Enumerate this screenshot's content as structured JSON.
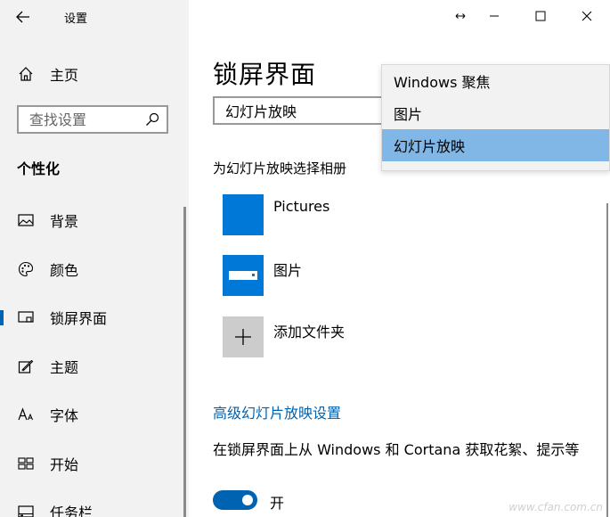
{
  "window": {
    "title": "设置"
  },
  "sidebar": {
    "home_label": "主页",
    "search_placeholder": "查找设置",
    "section_title": "个性化",
    "items": [
      {
        "label": "背景",
        "icon": "picture-icon"
      },
      {
        "label": "颜色",
        "icon": "palette-icon"
      },
      {
        "label": "锁屏界面",
        "icon": "lock-screen-icon",
        "active": true
      },
      {
        "label": "主题",
        "icon": "theme-icon"
      },
      {
        "label": "字体",
        "icon": "font-icon"
      },
      {
        "label": "开始",
        "icon": "start-icon"
      },
      {
        "label": "任务栏",
        "icon": "taskbar-icon"
      }
    ]
  },
  "main": {
    "page_title": "锁屏界面",
    "background_select_value": "幻灯片放映",
    "album_label": "为幻灯片放映选择相册",
    "folders": [
      {
        "name": "Pictures"
      },
      {
        "name": "图片"
      },
      {
        "name": "添加文件夹"
      }
    ],
    "advanced_link": "高级幻灯片放映设置",
    "fun_facts_label": "在锁屏界面上从 Windows 和 Cortana 获取花絮、提示等",
    "toggle_label": "开",
    "toggle_on": true,
    "watermark": "www.cfan.com.cn"
  },
  "dropdown": {
    "options": [
      "Windows 聚焦",
      "图片",
      "幻灯片放映"
    ],
    "selected_index": 2
  },
  "colors": {
    "accent": "#0063b1",
    "selected_highlight": "#81b7e6",
    "sidebar_bg": "#f2f2f2"
  }
}
